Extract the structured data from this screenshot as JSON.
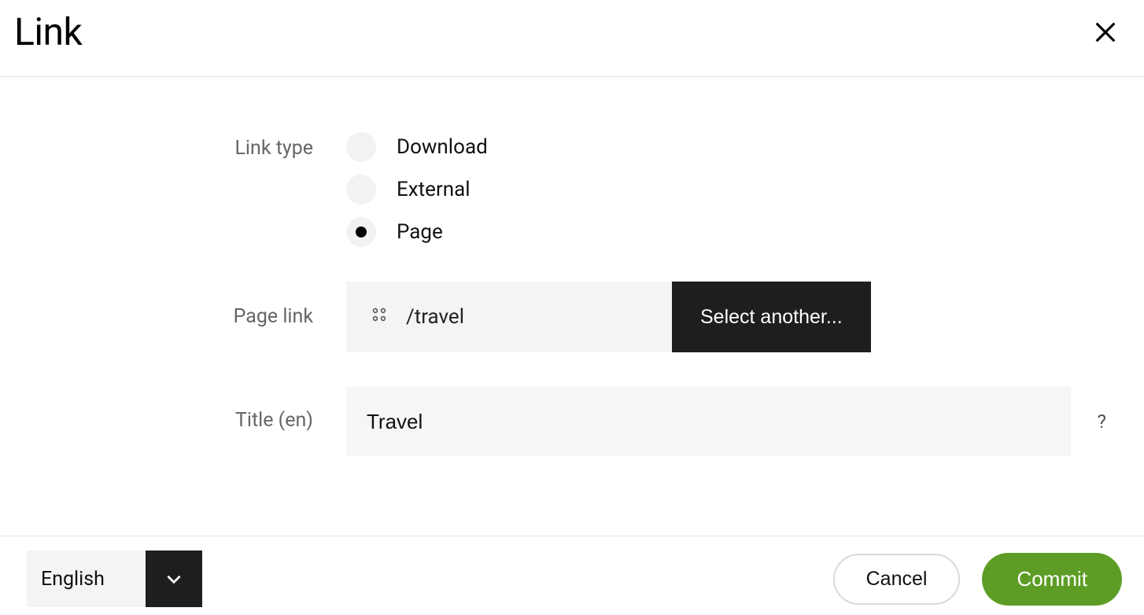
{
  "dialog": {
    "title": "Link"
  },
  "fields": {
    "link_type_label": "Link type",
    "link_type_options": [
      {
        "label": "Download",
        "value": "download",
        "selected": false
      },
      {
        "label": "External",
        "value": "external",
        "selected": false
      },
      {
        "label": "Page",
        "value": "page",
        "selected": true
      }
    ],
    "page_link_label": "Page link",
    "page_link_path": "/travel",
    "select_another_label": "Select another...",
    "title_label": "Title (en)",
    "title_value": "Travel",
    "help_symbol": "?"
  },
  "footer": {
    "language": "English",
    "cancel_label": "Cancel",
    "commit_label": "Commit"
  },
  "icons": {
    "close": "close-icon",
    "page": "page-dots-icon",
    "chevron_down": "chevron-down-icon"
  }
}
